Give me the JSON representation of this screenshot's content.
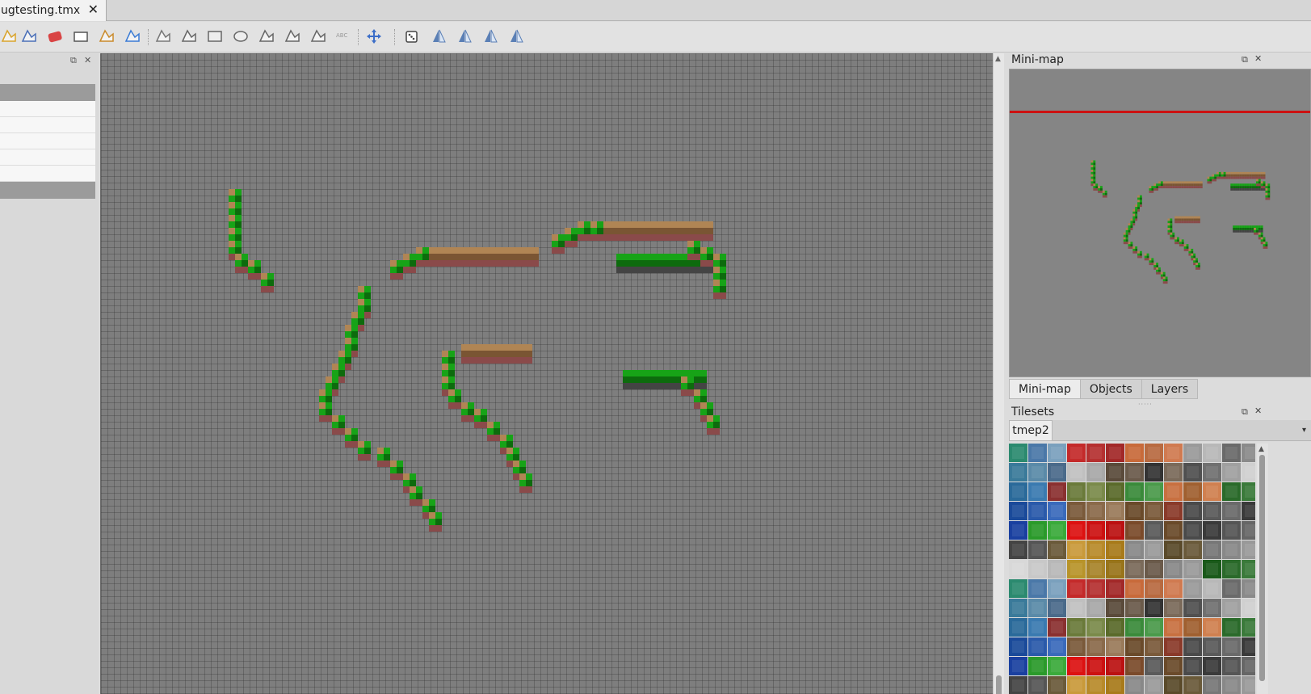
{
  "document_tab": {
    "label": "ugtesting.tmx",
    "close_glyph": "✕"
  },
  "toolbar": {
    "tools": [
      {
        "name": "stamp-brush-icon",
        "color": "#d9a32a"
      },
      {
        "name": "bucket-fill-icon",
        "color": "#4a6fb8"
      },
      {
        "name": "eraser-icon",
        "color": "#d94444"
      },
      {
        "name": "rectangular-select-icon",
        "color": "#555555"
      },
      {
        "name": "magic-wand-icon",
        "color": "#c98a2a"
      },
      {
        "name": "select-same-tile-icon",
        "color": "#3a7bd5"
      },
      {
        "name": "insert-tile-icon",
        "color": "#777777"
      },
      {
        "name": "edit-polygons-icon",
        "color": "#666666"
      },
      {
        "name": "insert-rectangle-icon",
        "color": "#666666"
      },
      {
        "name": "insert-ellipse-icon",
        "color": "#666666"
      },
      {
        "name": "insert-polygon-icon",
        "color": "#666666"
      },
      {
        "name": "insert-polyline-icon",
        "color": "#666666"
      },
      {
        "name": "insert-image-icon",
        "color": "#666666"
      },
      {
        "name": "insert-text-icon",
        "color": "#9a9a9a"
      },
      {
        "name": "move-icon",
        "color": "#3c6ec8"
      },
      {
        "name": "random-mode-icon",
        "color": "#444444"
      },
      {
        "name": "flip-horizontal-icon",
        "color": "#5a7fb5"
      },
      {
        "name": "flip-vertical-icon",
        "color": "#5a7fb5"
      },
      {
        "name": "rotate-left-icon",
        "color": "#5a7fb5"
      },
      {
        "name": "rotate-right-icon",
        "color": "#5a7fb5"
      }
    ]
  },
  "left_dock": {
    "float_glyph": "⧉",
    "close_glyph": "✕"
  },
  "minimap_panel": {
    "title": "Mini-map",
    "float_glyph": "⧉",
    "close_glyph": "✕"
  },
  "dock_tabs": [
    {
      "label": "Mini-map",
      "active": true
    },
    {
      "label": "Objects",
      "active": false
    },
    {
      "label": "Layers",
      "active": false
    }
  ],
  "tilesets_panel": {
    "title": "Tilesets",
    "float_glyph": "⧉",
    "close_glyph": "✕",
    "active_tileset": "tmep2",
    "menu_glyph": "▾"
  },
  "colors": {
    "grass": "#17a317",
    "grass_dark": "#0d6b0d",
    "dirt": "#b08554",
    "dirt_dark": "#7a5533",
    "brick": "#8a4a4a",
    "stone": "#444444",
    "minimap_marker": "#cc1111"
  }
}
